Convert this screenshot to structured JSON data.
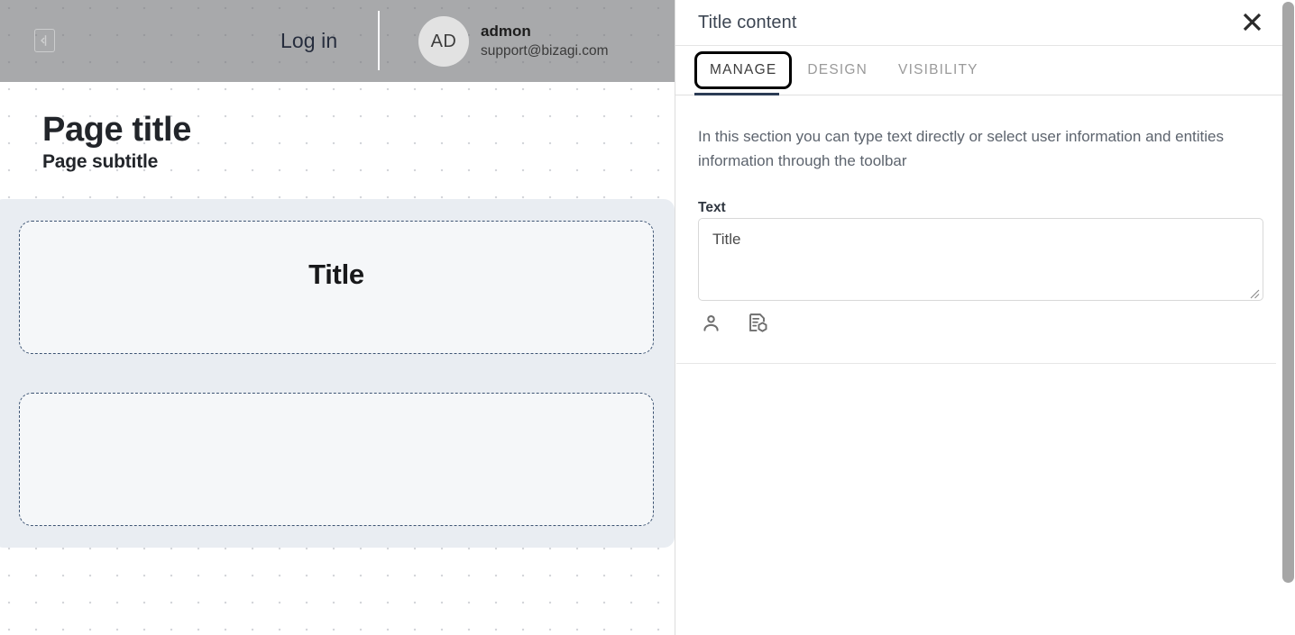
{
  "canvas": {
    "topbar": {
      "collapse_icon": "panel-collapse-icon",
      "login_label": "Log in",
      "user": {
        "initials": "AD",
        "name": "admon",
        "email": "support@bizagi.com"
      }
    },
    "page_title": "Page title",
    "page_subtitle": "Page subtitle",
    "widgets": [
      {
        "name": "title-widget",
        "text": "Title"
      },
      {
        "name": "empty-widget",
        "text": ""
      }
    ]
  },
  "panel": {
    "title": "Title content",
    "close_icon": "close-icon",
    "tabs": [
      {
        "label": "MANAGE",
        "active": true
      },
      {
        "label": "DESIGN",
        "active": false
      },
      {
        "label": "VISIBILITY",
        "active": false
      }
    ],
    "description": "In this section you can type text directly or select user information and entities information through the toolbar",
    "text_field": {
      "label": "Text",
      "value": "Title",
      "placeholder": ""
    },
    "toolbar_icons": [
      {
        "name": "user-info-icon",
        "title": "User information"
      },
      {
        "name": "entity-info-icon",
        "title": "Entity information"
      }
    ]
  },
  "colors": {
    "accent": "#2b3c55",
    "canvas_section_bg": "#e9edf2",
    "widget_dash": "#3d5473",
    "topbar_overlay": "#737578",
    "scrollbar": "#a6a6a6"
  }
}
